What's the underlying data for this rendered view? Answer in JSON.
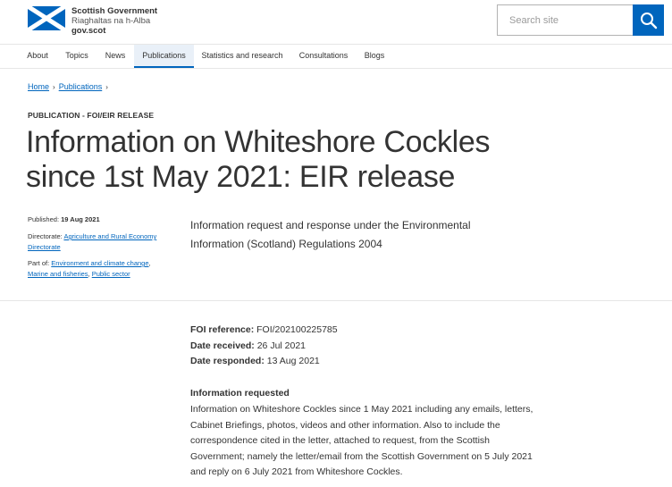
{
  "header": {
    "logo": {
      "line1": "Scottish Government",
      "line2": "Riaghaltas na h-Alba",
      "line3": "gov.scot"
    },
    "search": {
      "placeholder": "Search site"
    }
  },
  "nav": {
    "items": [
      {
        "label": "About"
      },
      {
        "label": "Topics"
      },
      {
        "label": "News"
      },
      {
        "label": "Publications"
      },
      {
        "label": "Statistics and research"
      },
      {
        "label": "Consultations"
      },
      {
        "label": "Blogs"
      }
    ]
  },
  "breadcrumb": {
    "home": "Home",
    "publications": "Publications",
    "separator": "›"
  },
  "page": {
    "label": "PUBLICATION - FOI/EIR RELEASE",
    "title": "Information on Whiteshore Cockles since 1st May 2021: EIR release",
    "summary": "Information request and response under the Environmental Information (Scotland) Regulations 2004"
  },
  "meta": {
    "published_label": "Published:",
    "published_value": "19 Aug 2021",
    "directorate_label": "Directorate:",
    "directorate_value": "Agriculture and Rural Economy Directorate",
    "partof_label": "Part of:",
    "partof_links": [
      "Environment and climate change",
      "Marine and fisheries",
      "Public sector"
    ]
  },
  "facts": {
    "foi_label": "FOI reference:",
    "foi_value": "FOI/202100225785",
    "received_label": "Date received:",
    "received_value": "26 Jul 2021",
    "responded_label": "Date responded:",
    "responded_value": "13 Aug 2021"
  },
  "request": {
    "title": "Information requested",
    "body": "Information on Whiteshore Cockles since 1 May 2021 including any emails, letters, Cabinet Briefings, photos, videos and other information. Also to include the correspondence cited in the letter, attached to request, from the Scottish Government; namely the letter/email from the Scottish Government on 5 July 2021 and reply on 6 July 2021 from Whiteshore Cockles."
  },
  "colors": {
    "brand_blue": "#0065bd",
    "text": "#333333"
  }
}
